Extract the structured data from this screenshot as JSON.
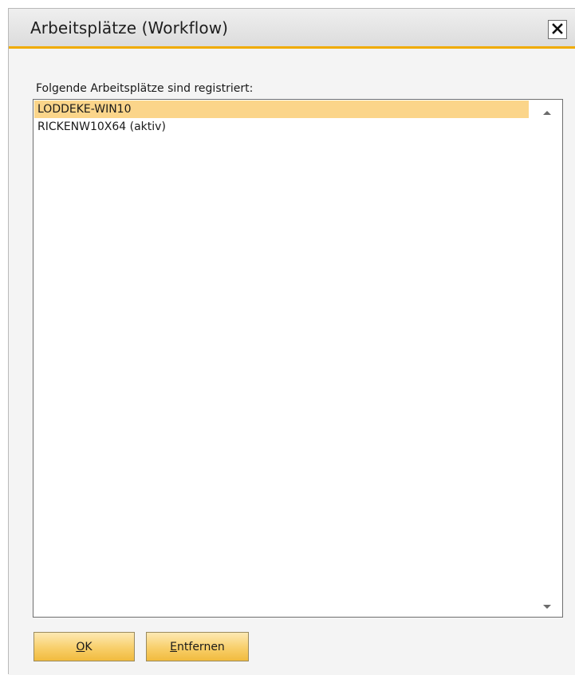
{
  "window": {
    "title": "Arbeitsplätze (Workflow)",
    "close_icon": "close-icon"
  },
  "workstations": {
    "label": "Folgende Arbeitsplätze sind registriert:",
    "items": [
      {
        "label": "LODDEKE-WIN10",
        "selected": true
      },
      {
        "label": "RICKENW10X64 (aktiv)",
        "selected": false
      }
    ]
  },
  "buttons": {
    "ok": {
      "mnemonic": "O",
      "rest": "K"
    },
    "remove": {
      "mnemonic": "E",
      "rest": "ntfernen"
    }
  },
  "colors": {
    "accent": "#f0ab00",
    "selection": "#fbd58a",
    "button": "#f8cf6a"
  }
}
